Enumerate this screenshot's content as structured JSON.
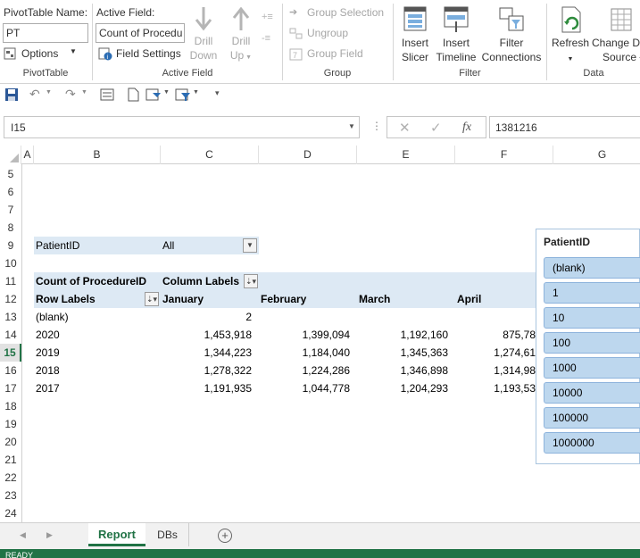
{
  "ribbon": {
    "pivottable_group": {
      "name_label": "PivotTable Name:",
      "name_value": "PT",
      "options_label": "Options",
      "group_label": "PivotTable"
    },
    "active_field_group": {
      "label": "Active Field:",
      "value": "Count of Procedu",
      "field_settings_label": "Field Settings",
      "drill_down_label": [
        "Drill",
        "Down"
      ],
      "drill_up_label": [
        "Drill",
        "Up"
      ],
      "group_label": "Active Field"
    },
    "group_group": {
      "group_selection": "Group Selection",
      "ungroup": "Ungroup",
      "group_field": "Group Field",
      "group_label": "Group"
    },
    "filter_group": {
      "insert_slicer": [
        "Insert",
        "Slicer"
      ],
      "insert_timeline": [
        "Insert",
        "Timeline"
      ],
      "filter_connections": [
        "Filter",
        "Connections"
      ],
      "group_label": "Filter"
    },
    "data_group": {
      "refresh": "Refresh",
      "change_source": [
        "Change D",
        "Source"
      ],
      "group_label": "Data"
    }
  },
  "formula_bar": {
    "name_box": "I15",
    "fx": "fx",
    "value": "1381216"
  },
  "columns": [
    "A",
    "B",
    "C",
    "D",
    "E",
    "F",
    "G"
  ],
  "rows": [
    "5",
    "6",
    "7",
    "8",
    "9",
    "10",
    "11",
    "12",
    "13",
    "14",
    "15",
    "16",
    "17",
    "18",
    "19",
    "20",
    "21",
    "22",
    "23",
    "24"
  ],
  "pivot": {
    "filter_field": "PatientID",
    "filter_value": "All",
    "values_label": "Count of ProcedureID",
    "column_labels": "Column Labels",
    "row_labels": "Row Labels",
    "months": [
      "January",
      "February",
      "March",
      "April"
    ],
    "data": [
      {
        "label": "(blank)",
        "values": [
          "2",
          "",
          "",
          ""
        ]
      },
      {
        "label": "2020",
        "values": [
          "1,453,918",
          "1,399,094",
          "1,192,160",
          "875,78"
        ]
      },
      {
        "label": "2019",
        "values": [
          "1,344,223",
          "1,184,040",
          "1,345,363",
          "1,274,61"
        ]
      },
      {
        "label": "2018",
        "values": [
          "1,278,322",
          "1,224,286",
          "1,346,898",
          "1,314,98"
        ]
      },
      {
        "label": "2017",
        "values": [
          "1,191,935",
          "1,044,778",
          "1,204,293",
          "1,193,53"
        ]
      }
    ]
  },
  "slicer": {
    "title": "PatientID",
    "items": [
      "(blank)",
      "1",
      "10",
      "100",
      "1000",
      "10000",
      "100000",
      "1000000"
    ]
  },
  "sheet_tabs": {
    "active": "Report",
    "other": "DBs",
    "add_symbol": "+"
  },
  "status": {
    "text": "READY"
  },
  "colors": {
    "accent": "#217346",
    "pivot_header": "#dde9f4",
    "slicer_item": "#bdd7ee"
  }
}
